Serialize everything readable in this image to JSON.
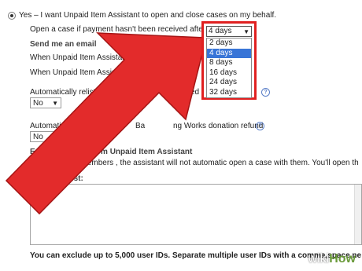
{
  "settings": {
    "yes_option": "Yes – I want Unpaid Item Assistant to open and close cases on my behalf.",
    "open_case_label": "Open a case if payment hasn't been received afte",
    "send_email_heading": "Send me an email",
    "email_line1": "When Unpaid Item Assistant opens a ca",
    "email_line2": "When Unpaid Item Assistant closes",
    "relist_label": "Automatically relist th",
    "relist_suffix": "sed",
    "relist_value": "No",
    "donation_label_a": "Automatically reque",
    "donation_label_b": "Ba",
    "donation_label_c": "ng Works donation refund",
    "donation_value": "No",
    "exclude_heading": "Exclude buyers from Unpaid Item Assistant",
    "exclude_desc": "If you exclude members , the assistant will not automatic open a case with them. You'll open th",
    "exclusion_label": "Exclusion list:",
    "footer_note": "You can exclude up to 5,000 user IDs. Separate multiple user IDs with a comma,space,ne"
  },
  "dropdown": {
    "selected": "4 days",
    "options": [
      "2 days",
      "4 days",
      "8 days",
      "16 days",
      "24 days",
      "32 days"
    ],
    "highlighted_index": 1
  },
  "colors": {
    "highlight_border": "#e02020",
    "arrow_fill": "#e32b2b",
    "selection_bg": "#3875d7"
  },
  "watermark": {
    "prefix": "wiki",
    "suffix": "How"
  }
}
